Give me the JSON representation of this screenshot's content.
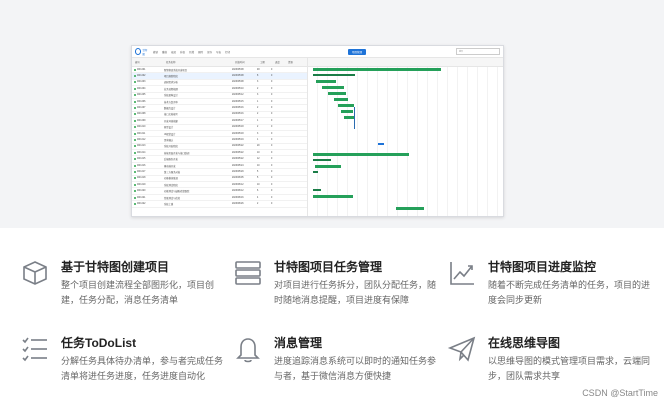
{
  "app_preview": {
    "toolbar": {
      "logo_text": "甘特图",
      "buttons": [
        "撤销",
        "重做",
        "缩进",
        "升级",
        "新增",
        "删除",
        "保存",
        "导出",
        "打印"
      ],
      "primary_button": "项目管理",
      "select_placeholder": "按天"
    },
    "grid_headers": [
      "编号",
      "任务名称",
      "开始时间",
      "工期",
      "进度",
      "资源"
    ],
    "rows": [
      {
        "id": "000-001",
        "name": "智慧物流系统开发项目",
        "start": "2023/05/08",
        "dur": "48",
        "pct": "0"
      },
      {
        "id": "000-002",
        "name": "项目规划阶段",
        "start": "2023/05/08",
        "dur": "8",
        "pct": "0"
      },
      {
        "id": "000-003",
        "name": "调研需求分析",
        "start": "2023/05/08",
        "dur": "3",
        "pct": "0"
      },
      {
        "id": "000-004",
        "name": "业务流程梳理",
        "start": "2023/05/10",
        "dur": "2",
        "pct": "0"
      },
      {
        "id": "000-005",
        "name": "系统架构设计",
        "start": "2023/05/12",
        "dur": "3",
        "pct": "0"
      },
      {
        "id": "000-006",
        "name": "技术方案评审",
        "start": "2023/05/15",
        "dur": "1",
        "pct": "0"
      },
      {
        "id": "000-007",
        "name": "数据库设计",
        "start": "2023/05/16",
        "dur": "2",
        "pct": "0"
      },
      {
        "id": "000-008",
        "name": "接口文档编写",
        "start": "2023/05/16",
        "dur": "2",
        "pct": "0"
      },
      {
        "id": "000-009",
        "name": "开发环境搭建",
        "start": "2023/05/17",
        "dur": "1",
        "pct": "0"
      },
      {
        "id": "000-010",
        "name": "原型设计",
        "start": "2023/05/18",
        "dur": "2",
        "pct": "0"
      },
      {
        "id": "000-011",
        "name": "UI视觉设计",
        "start": "2023/05/18",
        "dur": "3",
        "pct": "0"
      },
      {
        "id": "000-012",
        "name": "需求确认",
        "start": "2023/05/19",
        "dur": "1",
        "pct": "0"
      },
      {
        "id": "000-013",
        "name": "系统开发阶段",
        "start": "2023/05/22",
        "dur": "20",
        "pct": "0"
      },
      {
        "id": "000-014",
        "name": "前端页面开发与接口联调",
        "start": "2023/05/22",
        "dur": "10",
        "pct": "0"
      },
      {
        "id": "000-015",
        "name": "后端服务开发",
        "start": "2023/05/22",
        "dur": "12",
        "pct": "0"
      },
      {
        "id": "000-016",
        "name": "移动端开发",
        "start": "2023/05/24",
        "dur": "10",
        "pct": "0"
      },
      {
        "id": "000-017",
        "name": "第三方服务对接",
        "start": "2023/05/29",
        "dur": "5",
        "pct": "0"
      },
      {
        "id": "000-018",
        "name": "功能模块联调",
        "start": "2023/06/05",
        "dur": "5",
        "pct": "0"
      },
      {
        "id": "000-019",
        "name": "系统测试阶段",
        "start": "2023/06/12",
        "dur": "10",
        "pct": "0"
      },
      {
        "id": "000-020",
        "name": "功能测试与缺陷修复跟踪",
        "start": "2023/06/12",
        "dur": "6",
        "pct": "0"
      },
      {
        "id": "000-021",
        "name": "性能测试与优化",
        "start": "2023/06/16",
        "dur": "4",
        "pct": "0"
      },
      {
        "id": "000-022",
        "name": "系统上线",
        "start": "2023/06/26",
        "dur": "2",
        "pct": "0"
      }
    ]
  },
  "features": [
    {
      "icon": "cube-icon",
      "title": "基于甘特图创建项目",
      "desc": "整个项目创建流程全部图形化，项目创建，任务分配，消息任务清单"
    },
    {
      "icon": "server-list-icon",
      "title": "甘特图项目任务管理",
      "desc": "对项目进行任务拆分，团队分配任务，随时随地消息提醒，项目进度有保障"
    },
    {
      "icon": "trend-chart-icon",
      "title": "甘特图项目进度监控",
      "desc": "随着不断完成任务清单的任务，项目的进度会同步更新"
    },
    {
      "icon": "checklist-icon",
      "title": "任务ToDoList",
      "desc": "分解任务具体待办清单，参与者完成任务清单将进任务进度，任务进度自动化"
    },
    {
      "icon": "bell-icon",
      "title": "消息管理",
      "desc": "进度追踪消息系统可以即时的通知任务参与者，基于微信消息方便快捷"
    },
    {
      "icon": "paper-plane-icon",
      "title": "在线思维导图",
      "desc": "以思维导图的模式管理项目需求，云端同步，团队需求共享"
    }
  ],
  "watermark": "CSDN @StartTime"
}
